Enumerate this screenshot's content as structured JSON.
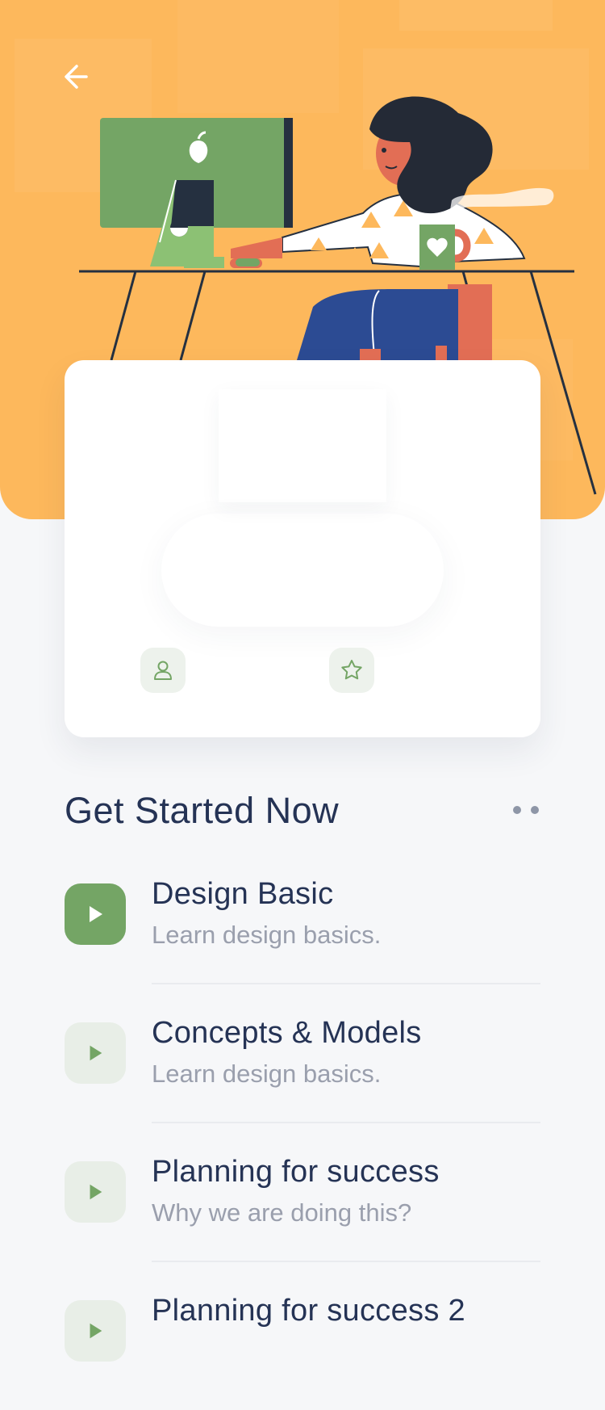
{
  "header": {
    "back_icon": "arrow-left-icon",
    "background_color": "#fdb85c"
  },
  "card": {
    "stats": [
      {
        "icon": "user-icon"
      },
      {
        "icon": "star-icon"
      }
    ]
  },
  "section": {
    "title": "Get Started Now",
    "more_icon": "more-dots-icon"
  },
  "lessons": [
    {
      "title": "Design Basic",
      "subtitle": "Learn design basics.",
      "icon": "play-icon",
      "active": true
    },
    {
      "title": "Concepts & Models",
      "subtitle": "Learn design basics.",
      "icon": "play-icon",
      "active": false
    },
    {
      "title": "Planning for success",
      "subtitle": "Why we are doing this?",
      "icon": "play-icon",
      "active": false
    },
    {
      "title": "Planning for success 2",
      "subtitle": "",
      "icon": "play-icon",
      "active": false
    }
  ],
  "colors": {
    "accent": "#74a565",
    "title": "#253355",
    "muted": "#9a9fad"
  }
}
